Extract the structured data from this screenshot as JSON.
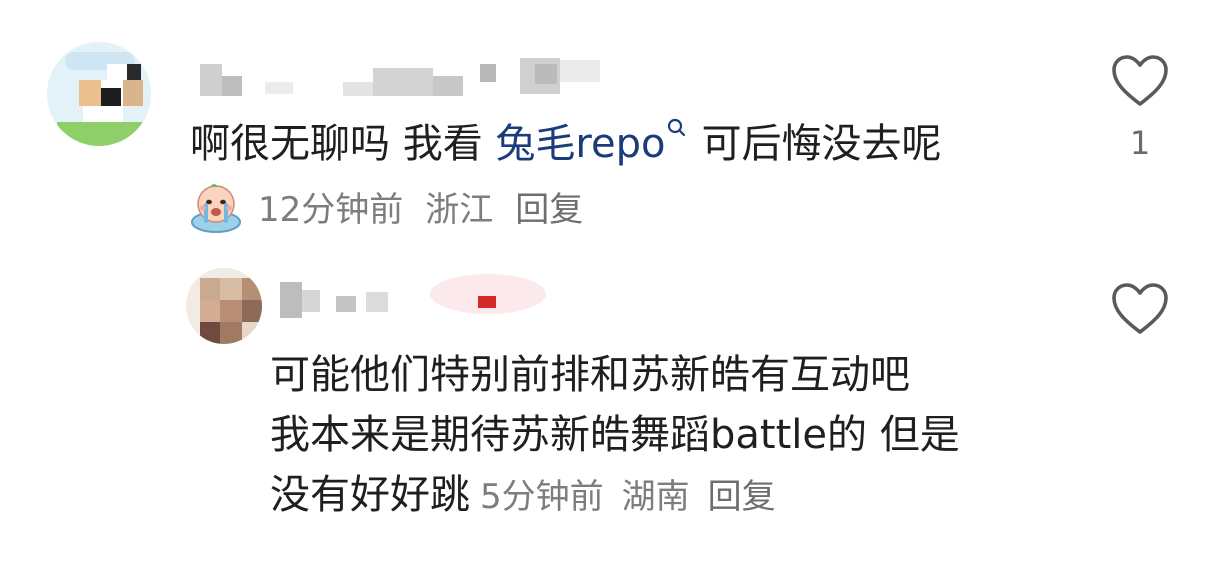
{
  "comments": [
    {
      "text_before": "啊很无聊吗 我看 ",
      "topic": "兔毛repo",
      "text_after": "可后悔没去呢",
      "time": "12分钟前",
      "location": "浙江",
      "reply_label": "回复",
      "like_count": "1",
      "emoji_icon": "crying-face-icon"
    },
    {
      "lines": [
        "可能他们特别前排和苏新皓有互动吧",
        "我本来是期待苏新皓舞蹈battle的 但是",
        "没有好好跳"
      ],
      "time": "5分钟前",
      "location": "湖南",
      "reply_label": "回复",
      "like_count": ""
    }
  ],
  "colors": {
    "topic_link": "#1b3c7a",
    "meta_text": "#7d7d7d",
    "heart_outline": "#5a5a5a"
  }
}
